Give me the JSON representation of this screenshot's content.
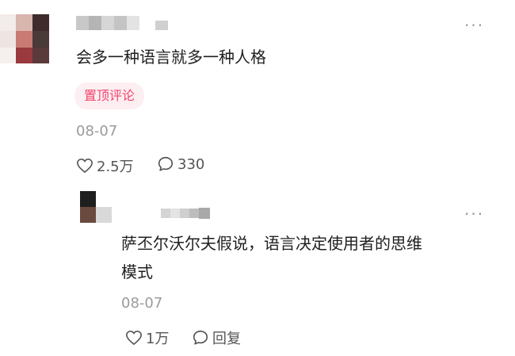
{
  "top_comment": {
    "text": "会多一种语言就多一种人格",
    "badge": "置顶评论",
    "date": "08-07",
    "likes": "2.5万",
    "replies": "330",
    "more": "···"
  },
  "reply_comment": {
    "text_line1": "萨丕尔沃尔夫假说，语言决定使用者的思维",
    "text_line2": "模式",
    "date": "08-07",
    "likes": "1万",
    "reply_label": "回复",
    "more": "···"
  },
  "colors": {
    "badge_bg": "#fdeef1",
    "badge_text": "#f2456e",
    "muted": "#9b9b9b"
  }
}
